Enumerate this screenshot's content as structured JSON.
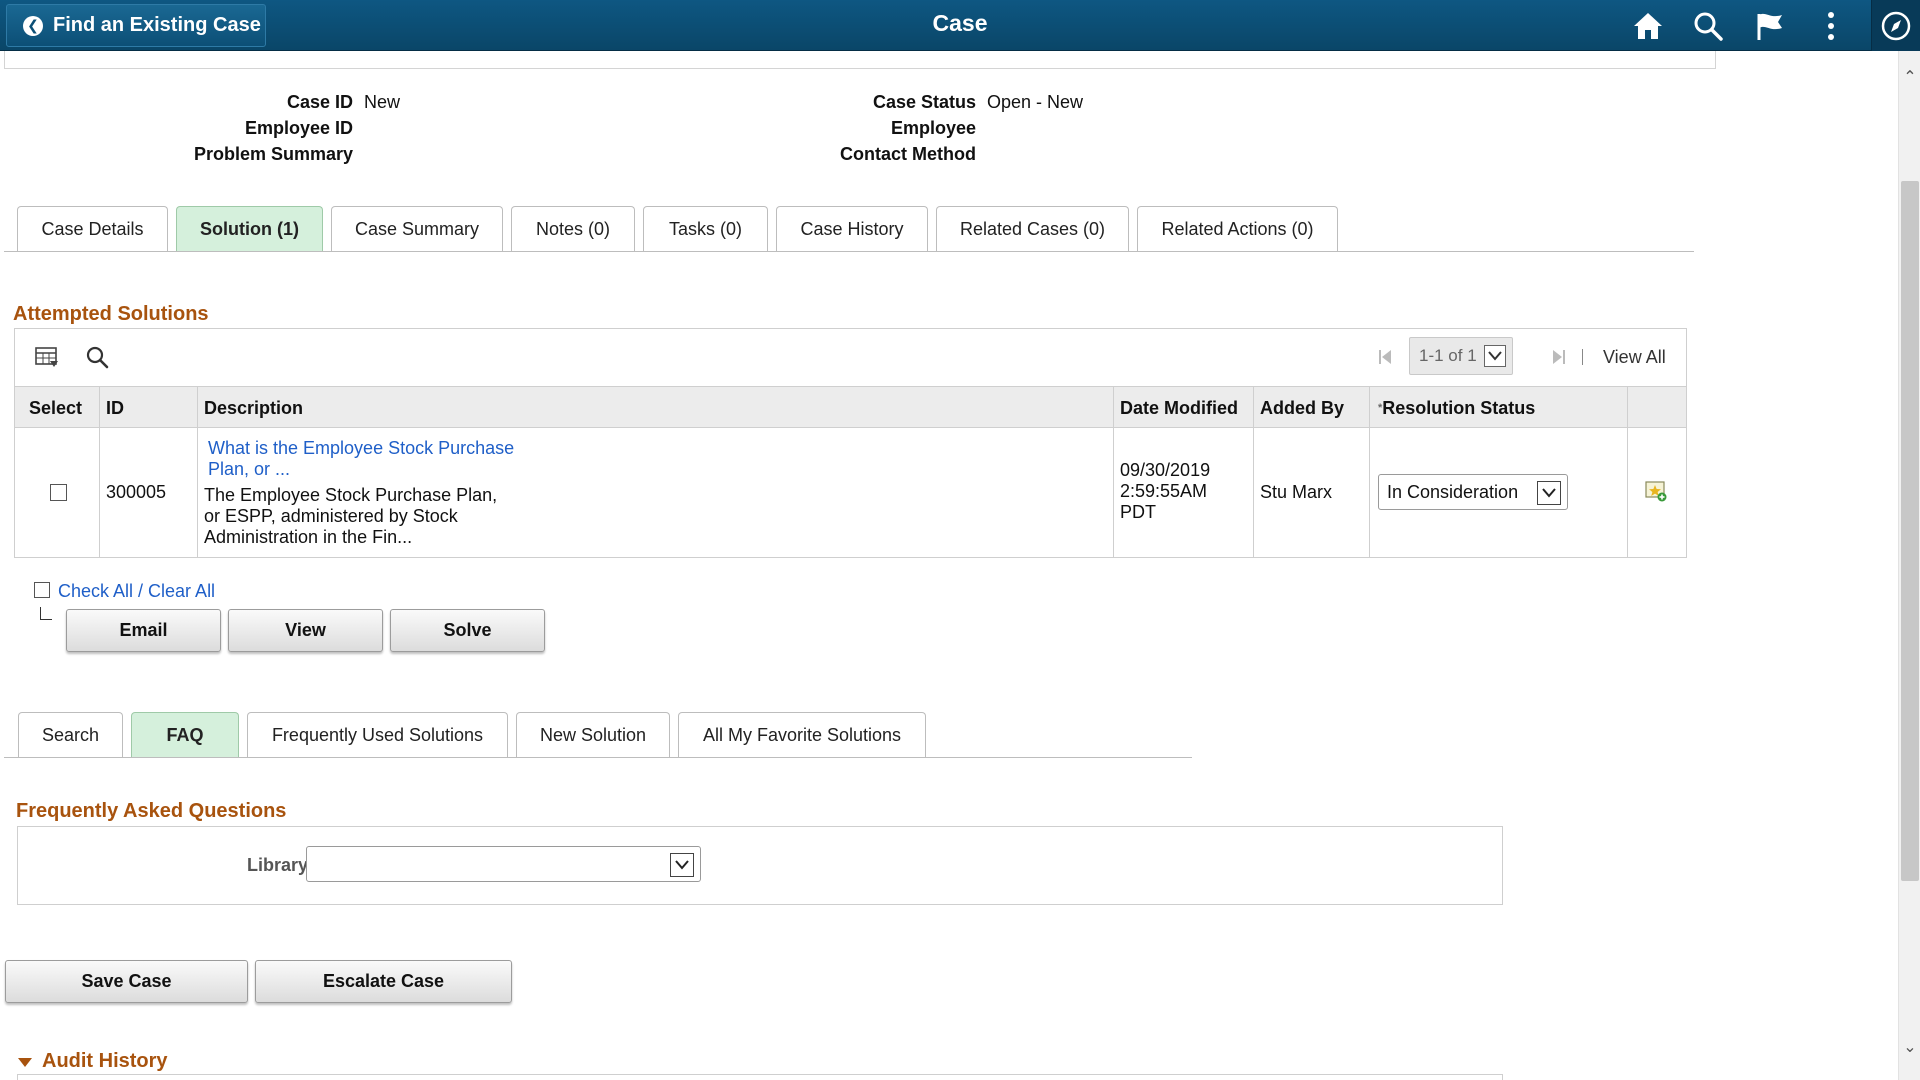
{
  "header": {
    "back_label": "Find an Existing Case",
    "title": "Case",
    "icons": [
      "home-icon",
      "search-icon",
      "flag-icon",
      "more-vertical-icon",
      "navigator-icon"
    ]
  },
  "case_info": {
    "case_id_label": "Case ID",
    "case_id_value": "New",
    "employee_id_label": "Employee ID",
    "problem_summary_label": "Problem Summary",
    "case_status_label": "Case Status",
    "case_status_value": "Open - New",
    "employee_label": "Employee",
    "contact_method_label": "Contact Method"
  },
  "main_tabs": [
    {
      "label": "Case Details",
      "active": false
    },
    {
      "label": "Solution (1)",
      "active": true
    },
    {
      "label": "Case Summary",
      "active": false
    },
    {
      "label": "Notes (0)",
      "active": false
    },
    {
      "label": "Tasks (0)",
      "active": false
    },
    {
      "label": "Case History",
      "active": false
    },
    {
      "label": "Related Cases (0)",
      "active": false
    },
    {
      "label": "Related Actions (0)",
      "active": false
    }
  ],
  "attempted_solutions": {
    "title": "Attempted Solutions",
    "pager_text": "1-1 of 1",
    "view_all": "View All",
    "columns": [
      "Select",
      "ID",
      "Description",
      "Date Modified",
      "Added By",
      "Resolution Status"
    ],
    "required_marker": "*",
    "rows": [
      {
        "id": "300005",
        "title_link_1": "What is the Employee Stock Purchase",
        "title_link_2": "Plan, or ...",
        "desc_1": "The Employee Stock Purchase Plan,",
        "desc_2": "or ESPP, administered by Stock",
        "desc_3": "Administration in the Fin...",
        "date_1": "09/30/2019",
        "date_2": "2:59:55AM",
        "date_3": "PDT",
        "added_by": "Stu Marx",
        "resolution_status": "In Consideration"
      }
    ],
    "check_all": "Check All / Clear All",
    "buttons": {
      "email": "Email",
      "view": "View",
      "solve": "Solve"
    }
  },
  "solution_tabs": [
    {
      "label": "Search",
      "active": false
    },
    {
      "label": "FAQ",
      "active": true
    },
    {
      "label": "Frequently Used Solutions",
      "active": false
    },
    {
      "label": "New Solution",
      "active": false
    },
    {
      "label": "All My Favorite Solutions",
      "active": false
    }
  ],
  "faq": {
    "title": "Frequently Asked Questions",
    "library_label": "Library",
    "library_value": ""
  },
  "footer_buttons": {
    "save_case": "Save Case",
    "escalate_case": "Escalate Case"
  },
  "audit_history": {
    "title": "Audit History"
  },
  "colors": {
    "header_bg": "#0c4f76",
    "active_tab": "#d5f0dc",
    "section_title": "#a8530e",
    "link": "#1f5fc8"
  }
}
